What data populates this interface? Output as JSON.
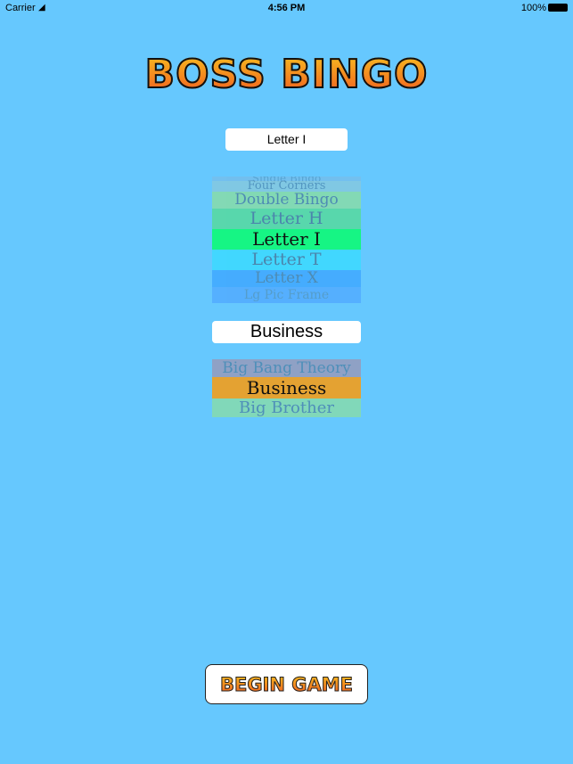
{
  "status": {
    "carrier": "Carrier",
    "time": "4:56 PM",
    "battery": "100%"
  },
  "logo": "BOSS BINGO",
  "pattern_field": "Letter I",
  "pattern_picker": [
    {
      "label": "Single Bingo",
      "color": "#7fb8e0"
    },
    {
      "label": "Four Corners",
      "color": "#8cc8d8"
    },
    {
      "label": "Double Bingo",
      "color": "#88dca8"
    },
    {
      "label": "Letter H",
      "color": "#58d8a8"
    },
    {
      "label": "Letter I",
      "color": "#16f584",
      "selected": true
    },
    {
      "label": "Letter T",
      "color": "#40d8ff"
    },
    {
      "label": "Letter X",
      "color": "#40a8ff"
    },
    {
      "label": "Lg Pic Frame",
      "color": "#4aa0ff"
    }
  ],
  "theme_field": "Business",
  "theme_picker": [
    {
      "label": "Big Bang Theory",
      "color": "#9a98b8"
    },
    {
      "label": "Business",
      "color": "#e4a232",
      "selected": true
    },
    {
      "label": "Big Brother",
      "color": "#88dca8"
    }
  ],
  "begin_button": "BEGIN GAME"
}
